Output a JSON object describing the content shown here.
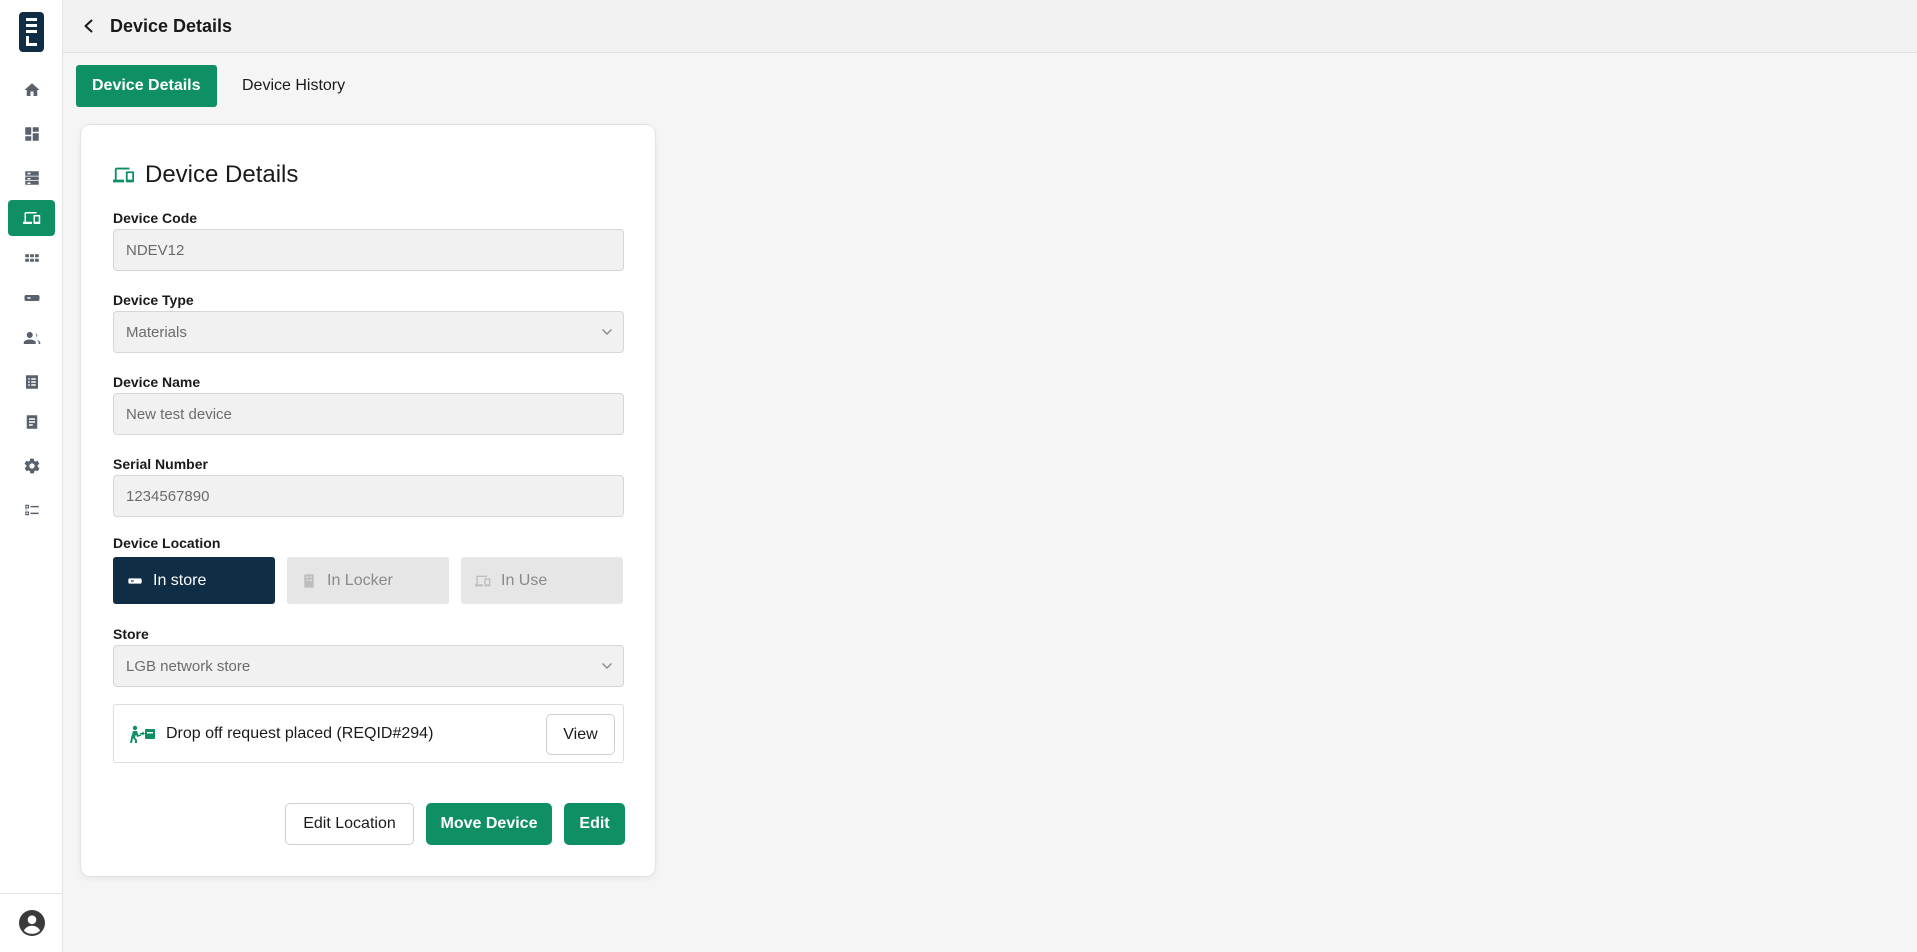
{
  "header": {
    "title": "Device Details"
  },
  "tabs": [
    {
      "label": "Device Details",
      "active": true
    },
    {
      "label": "Device History",
      "active": false
    }
  ],
  "sidebar": {
    "items": [
      {
        "icon": "home-icon"
      },
      {
        "icon": "dashboard-icon"
      },
      {
        "icon": "storage-icon"
      },
      {
        "icon": "devices-icon",
        "active": true
      },
      {
        "icon": "apps-grid-icon"
      },
      {
        "icon": "device-tag-icon"
      },
      {
        "icon": "users-icon"
      },
      {
        "icon": "list-icon"
      },
      {
        "icon": "document-icon"
      },
      {
        "icon": "gear-icon"
      },
      {
        "icon": "checklist-icon"
      }
    ],
    "accent_color": "#0f8f64"
  },
  "card": {
    "title": "Device Details",
    "fields": {
      "device_code": {
        "label": "Device Code",
        "value": "NDEV12"
      },
      "device_type": {
        "label": "Device Type",
        "value": "Materials"
      },
      "device_name": {
        "label": "Device Name",
        "value": "New test device"
      },
      "serial_number": {
        "label": "Serial Number",
        "value": "1234567890"
      },
      "store": {
        "label": "Store",
        "value": "LGB network store"
      }
    },
    "location": {
      "label": "Device Location",
      "options": [
        {
          "label": "In store",
          "selected": true
        },
        {
          "label": "In Locker",
          "selected": false
        },
        {
          "label": "In Use",
          "selected": false
        }
      ]
    },
    "request": {
      "text": "Drop off request placed (REQID#294)",
      "view_label": "View"
    },
    "actions": {
      "edit_location": "Edit Location",
      "move_device": "Move Device",
      "edit": "Edit"
    }
  },
  "colors": {
    "primary": "#0f8f64",
    "navy": "#0f2d44"
  }
}
